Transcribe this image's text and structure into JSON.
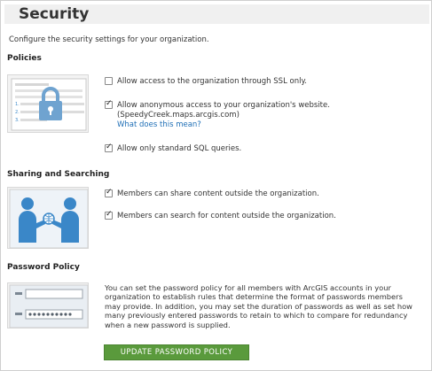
{
  "header": {
    "title": "Security"
  },
  "intro": "Configure the security settings for your organization.",
  "policies": {
    "heading": "Policies",
    "options": [
      {
        "label": "Allow access to the organization through SSL only.",
        "checked": false
      },
      {
        "label": "Allow anonymous access to your organization's website.",
        "sub": "(SpeedyCreek.maps.arcgis.com)",
        "link": "What does this mean?",
        "checked": true
      },
      {
        "label": "Allow only standard SQL queries.",
        "checked": true
      }
    ],
    "illustration_numbers": [
      "1.",
      "2.",
      "3."
    ]
  },
  "sharing": {
    "heading": "Sharing and Searching",
    "options": [
      {
        "label": "Members can share content outside the organization.",
        "checked": true
      },
      {
        "label": "Members can search for content outside the organization.",
        "checked": true
      }
    ]
  },
  "password": {
    "heading": "Password Policy",
    "description": "You can set the password policy for all members with ArcGIS accounts in your organization to establish rules that determine the format of passwords members may provide. In addition, you may set the duration of passwords as well as set how many previously entered passwords to retain to which to compare for redundancy when a new password is supplied.",
    "button_label": "UPDATE PASSWORD POLICY"
  },
  "colors": {
    "accent_blue": "#3a87c8",
    "button_green": "#5a9a3c",
    "link_blue": "#1f6fb6"
  }
}
